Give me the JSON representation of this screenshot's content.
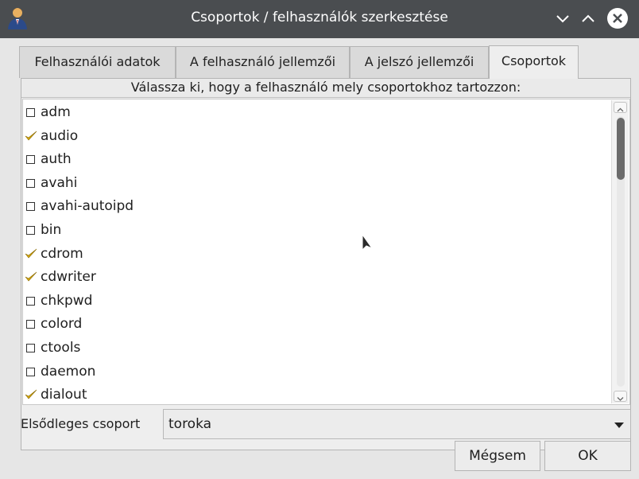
{
  "window": {
    "title": "Csoportok / felhasználók szerkesztése",
    "icon": "user-icon",
    "controls": [
      "chevron-down-icon",
      "chevron-up-icon",
      "close-icon"
    ]
  },
  "tabs": [
    {
      "label": "Felhasználói adatok",
      "active": false
    },
    {
      "label": "A felhasználó jellemzői",
      "active": false
    },
    {
      "label": "A jelszó jellemzői",
      "active": false
    },
    {
      "label": "Csoportok",
      "active": true
    }
  ],
  "groups_panel": {
    "prompt": "Válassza ki, hogy a felhasználó mely csoportokhoz tartozzon:",
    "items": [
      {
        "label": "adm",
        "checked": false
      },
      {
        "label": "audio",
        "checked": true
      },
      {
        "label": "auth",
        "checked": false
      },
      {
        "label": "avahi",
        "checked": false
      },
      {
        "label": "avahi-autoipd",
        "checked": false
      },
      {
        "label": "bin",
        "checked": false
      },
      {
        "label": "cdrom",
        "checked": true
      },
      {
        "label": "cdwriter",
        "checked": true
      },
      {
        "label": "chkpwd",
        "checked": false
      },
      {
        "label": "colord",
        "checked": false
      },
      {
        "label": "ctools",
        "checked": false
      },
      {
        "label": "daemon",
        "checked": false
      },
      {
        "label": "dialout",
        "checked": true
      }
    ]
  },
  "primary_group": {
    "label": "Elsődleges csoport",
    "value": "toroka"
  },
  "buttons": {
    "cancel": "Mégsem",
    "ok": "OK"
  },
  "colors": {
    "titlebar": "#4a4d50",
    "check": "#d8a800",
    "scroll_thumb": "#6b6b6b"
  }
}
